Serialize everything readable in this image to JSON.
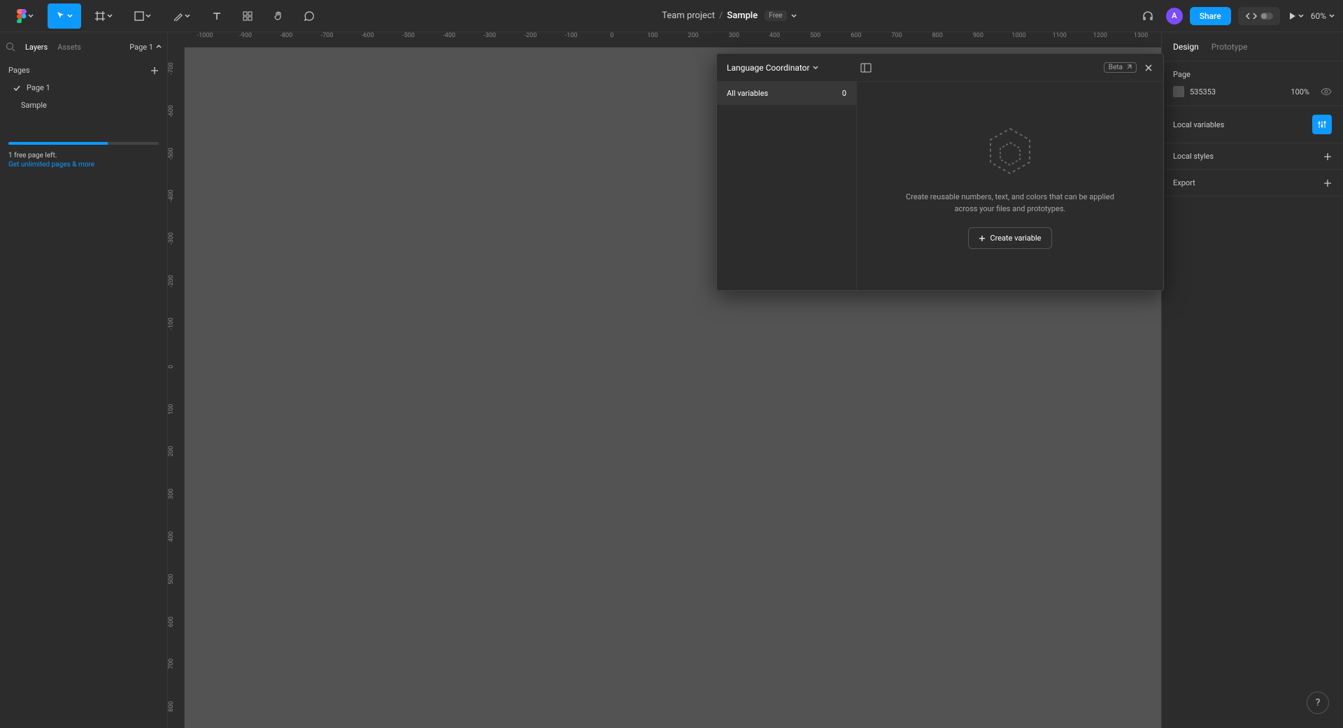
{
  "topbar": {
    "breadcrumb_team": "Team project",
    "breadcrumb_sep": "/",
    "doc_name": "Sample",
    "free_badge": "Free",
    "share_label": "Share",
    "zoom": "60%"
  },
  "left_panel": {
    "tab_layers": "Layers",
    "tab_assets": "Assets",
    "page_indicator": "Page 1",
    "pages_header": "Pages",
    "page_items": [
      "Page 1"
    ],
    "layer_items": [
      "Sample"
    ],
    "quota_text": "1 free page left.",
    "quota_link": "Get unlimited pages & more"
  },
  "ruler_h": [
    "-1000",
    "-900",
    "-800",
    "-700",
    "-600",
    "-500",
    "-400",
    "-300",
    "-200",
    "-100",
    "0",
    "100",
    "200",
    "300",
    "400",
    "500",
    "600",
    "700",
    "800",
    "900",
    "1000",
    "1100",
    "1200",
    "1300"
  ],
  "ruler_v": [
    "-700",
    "-600",
    "-500",
    "-400",
    "-300",
    "-200",
    "-100",
    "0",
    "100",
    "200",
    "300",
    "400",
    "500",
    "600",
    "700",
    "800"
  ],
  "right_panel": {
    "tab_design": "Design",
    "tab_prototype": "Prototype",
    "page_section": "Page",
    "bg_hex": "535353",
    "bg_opacity": "100%",
    "local_variables": "Local variables",
    "local_styles": "Local styles",
    "export": "Export"
  },
  "modal": {
    "title": "Language Coordinator",
    "beta": "Beta",
    "side_item_label": "All variables",
    "side_item_count": "0",
    "description": "Create reusable numbers, text, and colors that can be applied across your files and prototypes.",
    "create_btn": "Create variable"
  },
  "help": "?"
}
